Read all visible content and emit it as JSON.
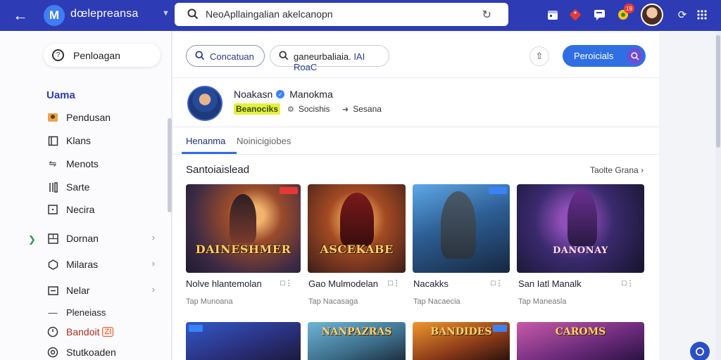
{
  "topbar": {
    "brand": "dœlepreansa",
    "search_text": "NeoApllaingalian akelcanopn",
    "notification_count": "19"
  },
  "sidebar": {
    "pill_label": "Penloagan",
    "section_heading": "Uama",
    "items": [
      {
        "label": "Pendusan",
        "icon": "gamepad-icon"
      },
      {
        "label": "Klans",
        "icon": "book-icon"
      },
      {
        "label": "Menots",
        "icon": "shuffle-icon"
      },
      {
        "label": "Sarte",
        "icon": "columns-icon"
      },
      {
        "label": "Necira",
        "icon": "square-icon"
      },
      {
        "label": "Dornan",
        "icon": "grid-icon"
      },
      {
        "label": "Milaras",
        "icon": "hexagon-icon"
      },
      {
        "label": "Nelar",
        "icon": "card-icon"
      },
      {
        "label": "Pleneiass",
        "icon": "dash-icon"
      },
      {
        "label": "Bandoit",
        "icon": "clock-icon",
        "badge": "ZI"
      },
      {
        "label": "Stutkoaden",
        "icon": "gear-icon"
      }
    ]
  },
  "toolbar": {
    "chip1": "Concatuan",
    "chip2_a": "ganeurbaliaia.",
    "chip2_b": "IAI RoaC",
    "primary": "Peroicials"
  },
  "profile": {
    "name_a": "Noakasn",
    "name_b": "Manokma",
    "tag": "Beanociks",
    "meta1": "Socishis",
    "meta2": "Sesana"
  },
  "tabs": {
    "active": "Henanma",
    "inactive": "Noinicigiobes"
  },
  "section": {
    "title": "Santoiaislead",
    "see_all": "Taolte Grana"
  },
  "games": [
    {
      "title": "Nolve hlantemolan",
      "sub": "Tap  Munoana",
      "art": "DAINESHMER"
    },
    {
      "title": "Gao Mulmodelan",
      "sub": "Tap  Nacasaga",
      "art": "ASCEKABE"
    },
    {
      "title": "Nacakks",
      "sub": "Tap  Nacaecia",
      "art": ""
    },
    {
      "title": "San Iatl Manalk",
      "sub": "Tap  Maneasla",
      "art": "DANONAY"
    }
  ],
  "games_row2": [
    {
      "art": ""
    },
    {
      "art": "NANPAZRAS"
    },
    {
      "art": "BANDIDES"
    },
    {
      "art": "CAROMS"
    }
  ],
  "colors": {
    "topbar": "#2d3bb5",
    "accent": "#2f6fe3",
    "heading": "#2d3bb5"
  }
}
